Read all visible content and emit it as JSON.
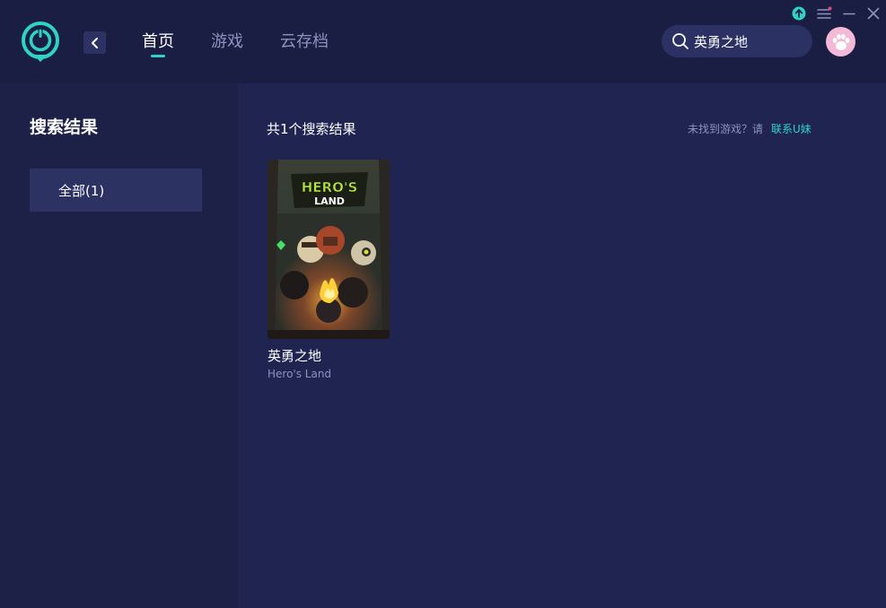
{
  "nav": {
    "tabs": [
      {
        "label": "首页",
        "active": true
      },
      {
        "label": "游戏",
        "active": false
      },
      {
        "label": "云存档",
        "active": false
      }
    ]
  },
  "search": {
    "value": "英勇之地"
  },
  "icons": {
    "logo": "app-logo-icon",
    "back": "chevron-left-icon",
    "search": "search-icon",
    "avatar": "paw-avatar-icon",
    "update": "upload-arrow-icon",
    "menu": "hamburger-menu-icon",
    "minimize": "minimize-icon",
    "close": "close-icon"
  },
  "colors": {
    "accent": "#2fd3c6",
    "badge": "#e0457b",
    "avatar_bg": "#f3b9d7"
  },
  "sidebar": {
    "title": "搜索结果",
    "filters": [
      {
        "label": "全部(1)",
        "selected": true
      }
    ]
  },
  "main": {
    "result_count": "共1个搜索结果",
    "not_found_text": "未找到游戏？请",
    "contact_link": "联系U妹",
    "games": [
      {
        "title": "英勇之地",
        "subtitle": "Hero's Land",
        "cover_text_line1": "HERO'S",
        "cover_text_line2": "LAND"
      }
    ]
  }
}
